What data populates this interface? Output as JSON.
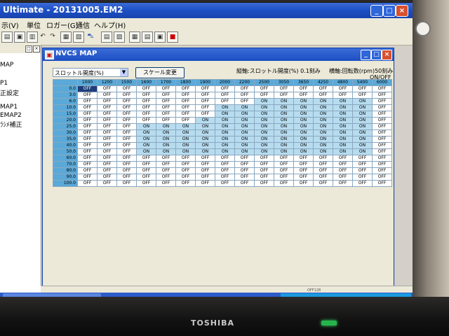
{
  "window": {
    "title": "Ultimate - 20131005.EM2"
  },
  "menu": [
    "表示(V)",
    "単位",
    "ロガー(G)",
    "通信",
    "ヘルプ(H)"
  ],
  "menu_partial_first": "示(V)",
  "sidebar": {
    "items": [
      "MAP",
      "P1",
      "正設定",
      "MAP1",
      "EMAP2",
      "ﾗｼﾒ補正"
    ]
  },
  "child": {
    "title": "NVCS MAP",
    "select_value": "スロットル開度(%)",
    "scale_button": "スケール変更",
    "vertical_axis": "縦軸:スロットル開度(%) 0.1刻み",
    "horizontal_axis": "横軸:回転数(rpm)50刻み",
    "value_unit": "ON/OFF"
  },
  "table": {
    "columns": [
      "1000",
      "1200",
      "1500",
      "1600",
      "1700",
      "1800",
      "1900",
      "2000",
      "2200",
      "2500",
      "3050",
      "3650",
      "4250",
      "4800",
      "5400",
      "6000"
    ],
    "rows": [
      {
        "label": "0.0",
        "cells": [
          "OFF",
          "OFF",
          "OFF",
          "OFF",
          "OFF",
          "OFF",
          "OFF",
          "OFF",
          "OFF",
          "OFF",
          "OFF",
          "OFF",
          "OFF",
          "OFF",
          "OFF",
          "OFF"
        ]
      },
      {
        "label": "3.0",
        "cells": [
          "OFF",
          "OFF",
          "OFF",
          "OFF",
          "OFF",
          "OFF",
          "OFF",
          "OFF",
          "OFF",
          "OFF",
          "OFF",
          "OFF",
          "OFF",
          "OFF",
          "OFF",
          "OFF"
        ]
      },
      {
        "label": "6.0",
        "cells": [
          "OFF",
          "OFF",
          "OFF",
          "OFF",
          "OFF",
          "OFF",
          "OFF",
          "OFF",
          "OFF",
          "ON",
          "ON",
          "ON",
          "ON",
          "ON",
          "ON",
          "OFF"
        ]
      },
      {
        "label": "10.0",
        "cells": [
          "OFF",
          "OFF",
          "OFF",
          "OFF",
          "OFF",
          "OFF",
          "OFF",
          "ON",
          "ON",
          "ON",
          "ON",
          "ON",
          "ON",
          "ON",
          "ON",
          "OFF"
        ]
      },
      {
        "label": "15.0",
        "cells": [
          "OFF",
          "OFF",
          "OFF",
          "OFF",
          "OFF",
          "OFF",
          "OFF",
          "ON",
          "ON",
          "ON",
          "ON",
          "ON",
          "ON",
          "ON",
          "ON",
          "OFF"
        ]
      },
      {
        "label": "20.0",
        "cells": [
          "OFF",
          "OFF",
          "OFF",
          "OFF",
          "OFF",
          "OFF",
          "ON",
          "ON",
          "ON",
          "ON",
          "ON",
          "ON",
          "ON",
          "ON",
          "ON",
          "OFF"
        ]
      },
      {
        "label": "25.0",
        "cells": [
          "OFF",
          "OFF",
          "OFF",
          "ON",
          "ON",
          "ON",
          "ON",
          "ON",
          "ON",
          "ON",
          "ON",
          "ON",
          "ON",
          "ON",
          "ON",
          "OFF"
        ]
      },
      {
        "label": "30.0",
        "cells": [
          "OFF",
          "OFF",
          "OFF",
          "ON",
          "ON",
          "ON",
          "ON",
          "ON",
          "ON",
          "ON",
          "ON",
          "ON",
          "ON",
          "ON",
          "ON",
          "OFF"
        ]
      },
      {
        "label": "35.0",
        "cells": [
          "OFF",
          "OFF",
          "OFF",
          "ON",
          "ON",
          "ON",
          "ON",
          "ON",
          "ON",
          "ON",
          "ON",
          "ON",
          "ON",
          "ON",
          "ON",
          "OFF"
        ]
      },
      {
        "label": "40.0",
        "cells": [
          "OFF",
          "OFF",
          "OFF",
          "ON",
          "ON",
          "ON",
          "ON",
          "ON",
          "ON",
          "ON",
          "ON",
          "ON",
          "ON",
          "ON",
          "ON",
          "OFF"
        ]
      },
      {
        "label": "50.0",
        "cells": [
          "OFF",
          "OFF",
          "OFF",
          "ON",
          "ON",
          "ON",
          "ON",
          "ON",
          "ON",
          "ON",
          "ON",
          "ON",
          "ON",
          "ON",
          "ON",
          "OFF"
        ]
      },
      {
        "label": "60.0",
        "cells": [
          "OFF",
          "OFF",
          "OFF",
          "OFF",
          "OFF",
          "OFF",
          "OFF",
          "OFF",
          "OFF",
          "OFF",
          "OFF",
          "OFF",
          "OFF",
          "OFF",
          "OFF",
          "OFF"
        ]
      },
      {
        "label": "70.0",
        "cells": [
          "OFF",
          "OFF",
          "OFF",
          "OFF",
          "OFF",
          "OFF",
          "OFF",
          "OFF",
          "OFF",
          "OFF",
          "OFF",
          "OFF",
          "OFF",
          "OFF",
          "OFF",
          "OFF"
        ]
      },
      {
        "label": "80.0",
        "cells": [
          "OFF",
          "OFF",
          "OFF",
          "OFF",
          "OFF",
          "OFF",
          "OFF",
          "OFF",
          "OFF",
          "OFF",
          "OFF",
          "OFF",
          "OFF",
          "OFF",
          "OFF",
          "OFF"
        ]
      },
      {
        "label": "90.0",
        "cells": [
          "OFF",
          "OFF",
          "OFF",
          "OFF",
          "OFF",
          "OFF",
          "OFF",
          "OFF",
          "OFF",
          "OFF",
          "OFF",
          "OFF",
          "OFF",
          "OFF",
          "OFF",
          "OFF"
        ]
      },
      {
        "label": "100.0",
        "cells": [
          "OFF",
          "OFF",
          "OFF",
          "OFF",
          "OFF",
          "OFF",
          "OFF",
          "OFF",
          "OFF",
          "OFF",
          "OFF",
          "OFF",
          "OFF",
          "OFF",
          "OFF",
          "OFF"
        ]
      }
    ],
    "selected": {
      "row": 0,
      "col": 0
    }
  },
  "statusbar": {
    "right": "OFF128"
  },
  "monitor": {
    "brand": "TOSHIBA"
  },
  "colors": {
    "header": "#5aa9d8",
    "on_cell": "#b7dcef",
    "off_cell": "#ffffff",
    "selected": "#1e3d7a",
    "titlebar": "#1c4fc4"
  }
}
